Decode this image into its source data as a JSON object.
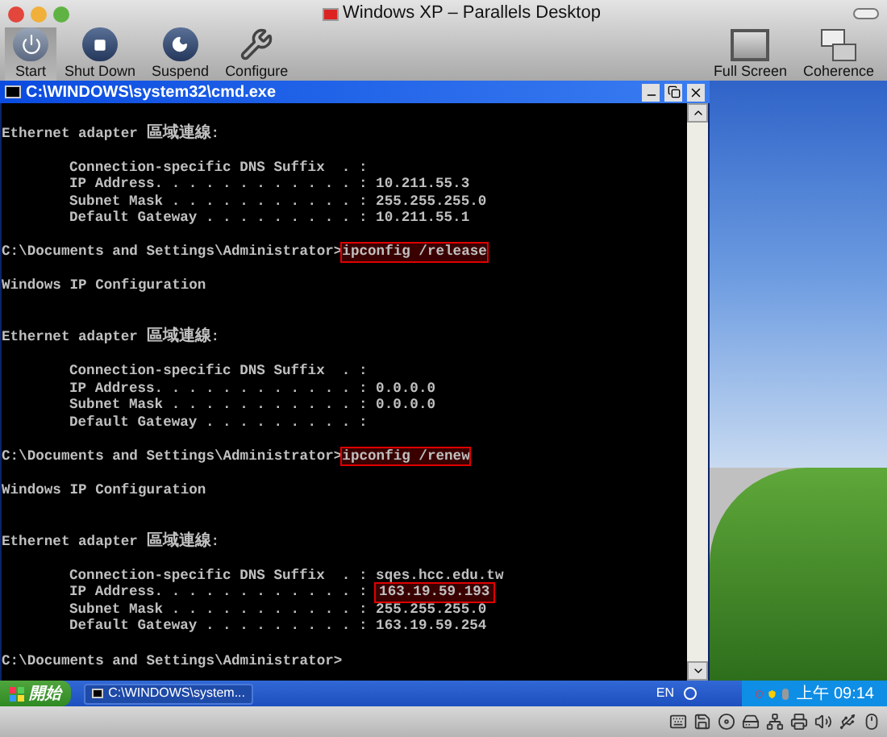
{
  "window": {
    "title": "Windows XP – Parallels Desktop"
  },
  "toolbar": {
    "left": [
      {
        "label": "Start",
        "kind": "start",
        "active": true
      },
      {
        "label": "Shut Down",
        "kind": "stop",
        "active": false
      },
      {
        "label": "Suspend",
        "kind": "suspend",
        "active": false
      },
      {
        "label": "Configure",
        "kind": "configure",
        "active": false
      }
    ],
    "right": [
      {
        "label": "Full Screen",
        "kind": "fullscreen",
        "active": false
      },
      {
        "label": "Coherence",
        "kind": "coherence",
        "active": false
      }
    ]
  },
  "cmd_window": {
    "title": "C:\\WINDOWS\\system32\\cmd.exe",
    "lines": [
      {
        "kind": "blank"
      },
      {
        "kind": "adapter",
        "text": "Ethernet adapter ",
        "name": "區域連線",
        "suffix": ":"
      },
      {
        "kind": "blank"
      },
      {
        "kind": "field",
        "label": "Connection-specific DNS Suffix  . :"
      },
      {
        "kind": "field",
        "label": "IP Address. . . . . . . . . . . . :",
        "value": "10.211.55.3",
        "highlighted": false
      },
      {
        "kind": "field",
        "label": "Subnet Mask . . . . . . . . . . . :",
        "value": "255.255.255.0",
        "highlighted": false
      },
      {
        "kind": "field",
        "label": "Default Gateway . . . . . . . . . :",
        "value": "10.211.55.1",
        "highlighted": false
      },
      {
        "kind": "blank"
      },
      {
        "kind": "prompt",
        "prompt": "C:\\Documents and Settings\\Administrator>",
        "command": "ipconfig /release",
        "highlighted": true
      },
      {
        "kind": "blank"
      },
      {
        "kind": "text",
        "text": "Windows IP Configuration"
      },
      {
        "kind": "blank"
      },
      {
        "kind": "blank"
      },
      {
        "kind": "adapter",
        "text": "Ethernet adapter ",
        "name": "區域連線",
        "suffix": ":"
      },
      {
        "kind": "blank"
      },
      {
        "kind": "field",
        "label": "Connection-specific DNS Suffix  . :"
      },
      {
        "kind": "field",
        "label": "IP Address. . . . . . . . . . . . :",
        "value": "0.0.0.0",
        "highlighted": false
      },
      {
        "kind": "field",
        "label": "Subnet Mask . . . . . . . . . . . :",
        "value": "0.0.0.0",
        "highlighted": false
      },
      {
        "kind": "field",
        "label": "Default Gateway . . . . . . . . . :"
      },
      {
        "kind": "blank"
      },
      {
        "kind": "prompt",
        "prompt": "C:\\Documents and Settings\\Administrator>",
        "command": "ipconfig /renew",
        "highlighted": true
      },
      {
        "kind": "blank"
      },
      {
        "kind": "text",
        "text": "Windows IP Configuration"
      },
      {
        "kind": "blank"
      },
      {
        "kind": "blank"
      },
      {
        "kind": "adapter",
        "text": "Ethernet adapter ",
        "name": "區域連線",
        "suffix": ":"
      },
      {
        "kind": "blank"
      },
      {
        "kind": "field",
        "label": "Connection-specific DNS Suffix  . :",
        "value": "sqes.hcc.edu.tw",
        "highlighted": false
      },
      {
        "kind": "field",
        "label": "IP Address. . . . . . . . . . . . :",
        "value": "163.19.59.193",
        "highlighted": true
      },
      {
        "kind": "field",
        "label": "Subnet Mask . . . . . . . . . . . :",
        "value": "255.255.255.0",
        "highlighted": false
      },
      {
        "kind": "field",
        "label": "Default Gateway . . . . . . . . . :",
        "value": "163.19.59.254",
        "highlighted": false
      },
      {
        "kind": "blank"
      },
      {
        "kind": "prompt",
        "prompt": "C:\\Documents and Settings\\Administrator>"
      }
    ]
  },
  "taskbar": {
    "start": "開始",
    "task": "C:\\WINDOWS\\system...",
    "language": "EN",
    "clock": "上午 09:14"
  }
}
